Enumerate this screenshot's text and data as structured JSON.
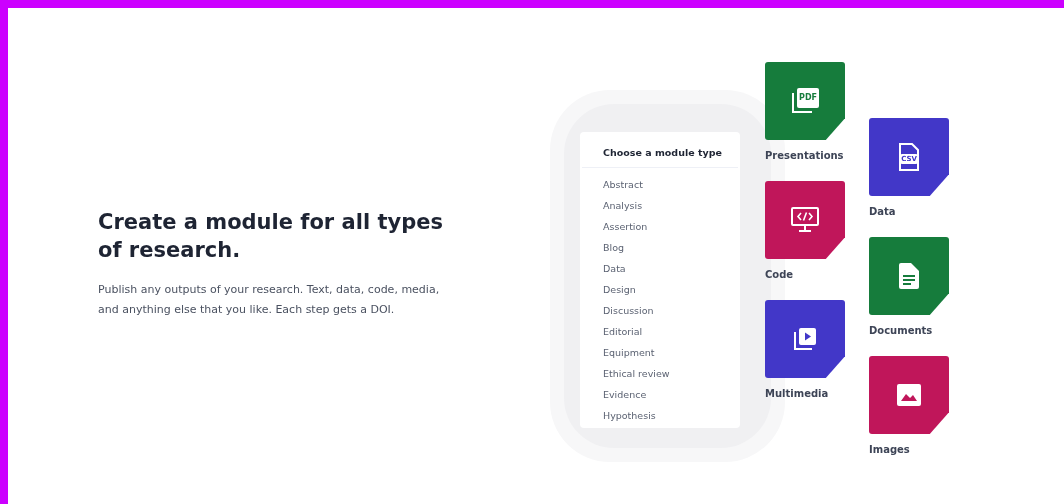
{
  "heading": "Create a module for all types of research.",
  "description": "Publish any outputs of your research. Text, data, code, media, and anything else that you like. Each step gets a DOI.",
  "module_menu": {
    "title": "Choose a module type",
    "items": [
      "Abstract",
      "Analysis",
      "Assertion",
      "Blog",
      "Data",
      "Design",
      "Discussion",
      "Editorial",
      "Equipment",
      "Ethical review",
      "Evidence",
      "Hypothesis"
    ]
  },
  "tile_columns": [
    [
      {
        "kind": "pdf",
        "badge": "PDF",
        "label": "Presentations",
        "color": "#167c3c"
      },
      {
        "kind": "code",
        "label": "Code",
        "color": "#c0165a"
      },
      {
        "kind": "video",
        "label": "Multimedia",
        "color": "#4237c8"
      }
    ],
    [
      {
        "kind": "csv",
        "badge": "CSV",
        "label": "Data",
        "color": "#4237c8"
      },
      {
        "kind": "document",
        "label": "Documents",
        "color": "#167c3c"
      },
      {
        "kind": "image",
        "label": "Images",
        "color": "#c0165a"
      }
    ]
  ]
}
